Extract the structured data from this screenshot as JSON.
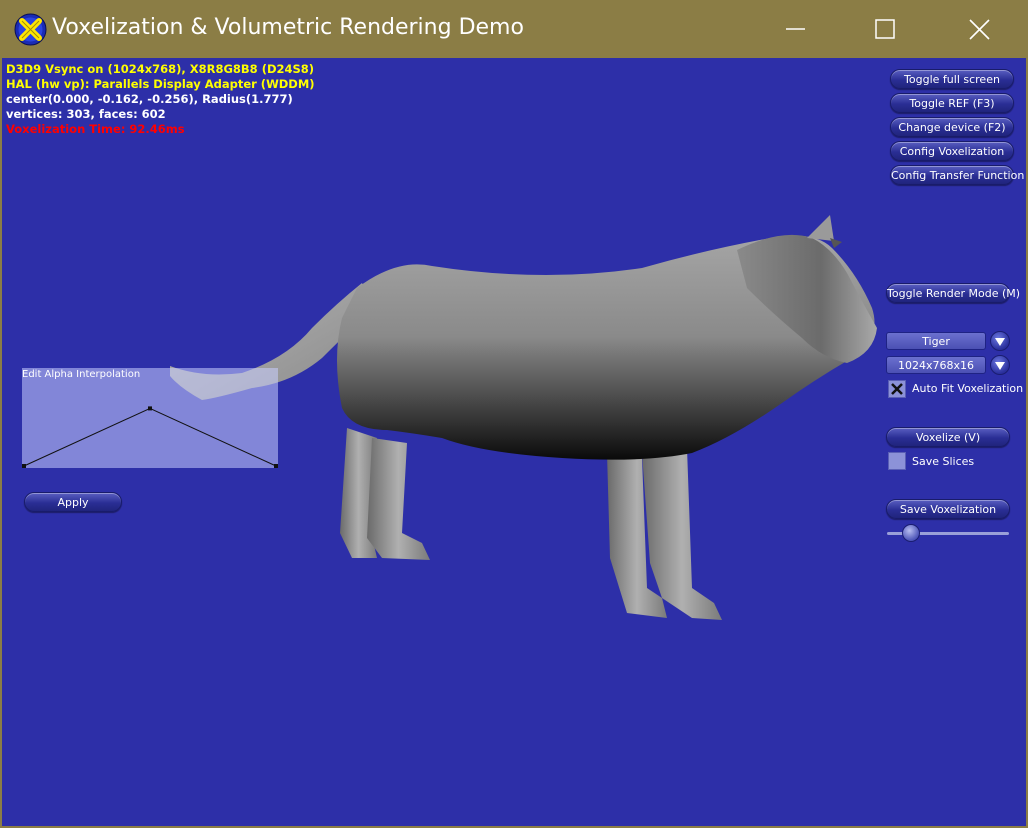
{
  "window": {
    "title": "Voxelization & Volumetric Rendering Demo",
    "icon": "directx-x-icon",
    "controls": [
      "minimize-icon",
      "maximize-icon",
      "close-icon"
    ]
  },
  "stats": {
    "line1": "D3D9 Vsync on (1024x768), X8R8G8B8 (D24S8)",
    "line2": "HAL (hw vp): Parallels Display Adapter (WDDM)",
    "line3": "center(0.000, -0.162, -0.256), Radius(1.777)",
    "line4": "vertices: 303, faces: 602",
    "line5": "Voxelization Time: 92.46ms"
  },
  "buttons": {
    "toggle_full_screen": "Toggle full screen",
    "toggle_ref": "Toggle REF (F3)",
    "change_device": "Change device (F2)",
    "config_voxelization": "Config Voxelization",
    "config_transfer_function": "Config Transfer Function",
    "toggle_render_mode": "Toggle Render Mode (M)",
    "voxelize": "Voxelize (V)",
    "save_voxelization": "Save Voxelization",
    "apply": "Apply"
  },
  "model_select": {
    "selected": "Tiger"
  },
  "resolution_select": {
    "selected": "1024x768x16"
  },
  "auto_fit": {
    "label": "Auto Fit Voxelization Bo",
    "checked": true
  },
  "save_slices": {
    "label": "Save Slices",
    "checked": false
  },
  "alpha_editor": {
    "label": "Edit Alpha Interpolation",
    "control_points": [
      [
        0,
        0
      ],
      [
        0.5,
        0.6
      ],
      [
        1,
        0
      ]
    ]
  },
  "slider": {
    "value": 0.2
  },
  "colors": {
    "viewport_bg": "#2d2fa8",
    "titlebar": "#8b7d45",
    "stats_yellow": "#ffff00",
    "stats_red": "#ff0000"
  }
}
